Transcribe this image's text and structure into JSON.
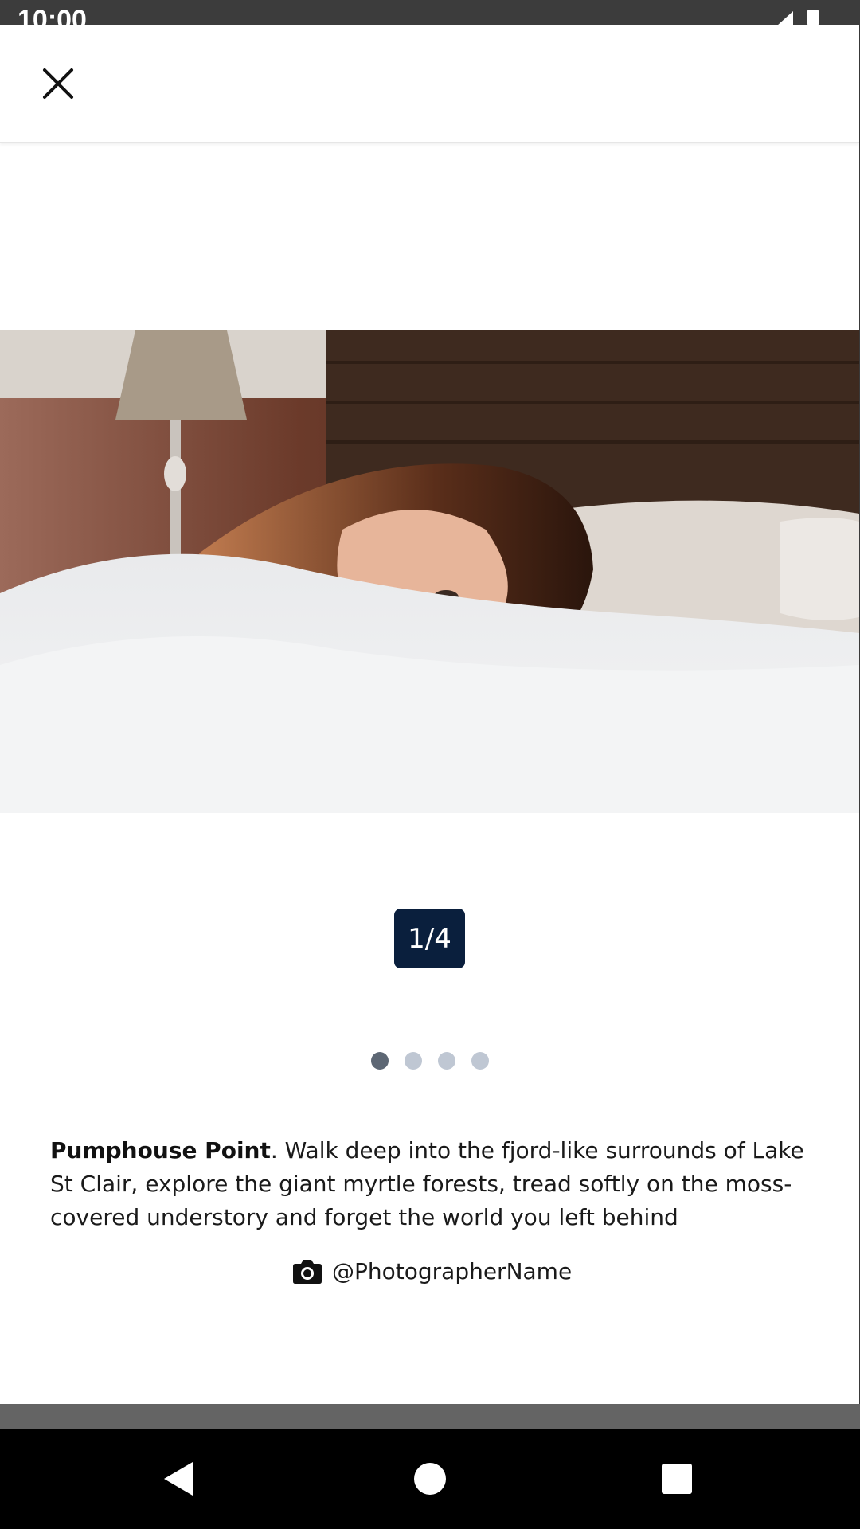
{
  "status_bar": {
    "time": "10:00"
  },
  "top_bar": {
    "close_icon": "close-icon"
  },
  "gallery": {
    "counter": "1/4",
    "total": 4,
    "active_index": 0
  },
  "caption": {
    "title": "Pumphouse Point",
    "body": ". Walk deep into the fjord-like surrounds of Lake St Clair, explore the giant myrtle forests, tread softly on the moss-covered understory and forget the world you left behind"
  },
  "credit": {
    "icon": "camera-icon",
    "handle": "@PhotographerName"
  },
  "colors": {
    "counter_bg": "#0a1f3d",
    "dot_active": "#5d6774",
    "dot_inactive": "#bfc7d3"
  }
}
